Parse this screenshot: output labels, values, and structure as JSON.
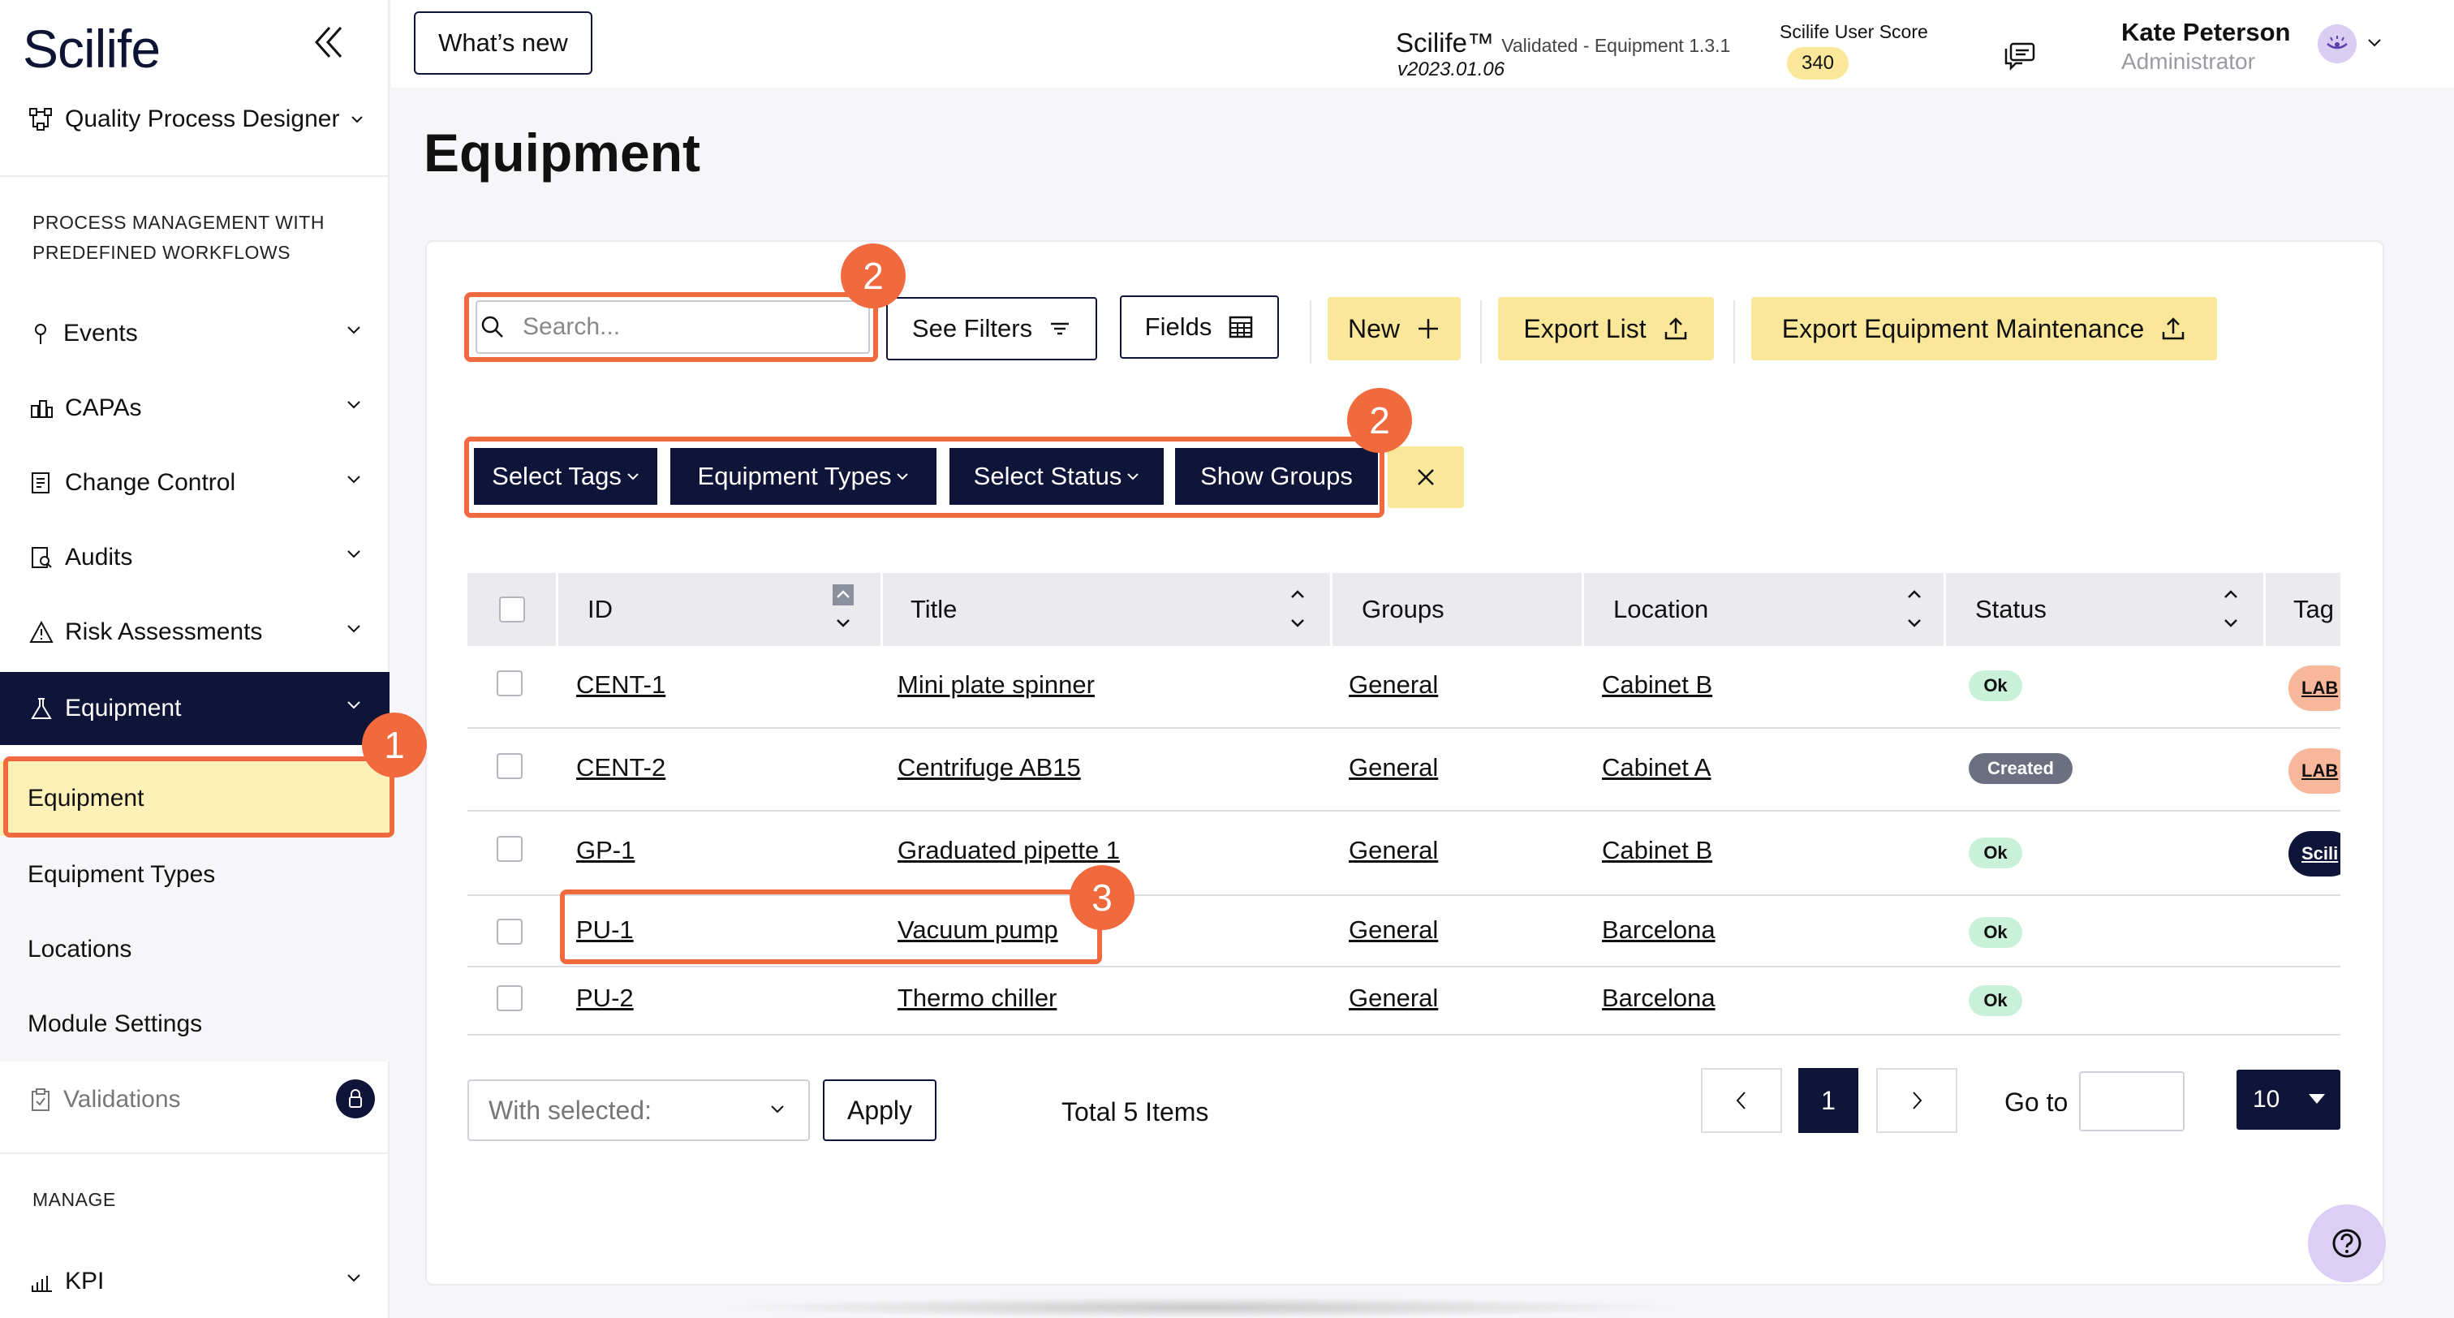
{
  "sidebar": {
    "logo": "Scilife",
    "module": "Quality Process Designer",
    "section1_line1": "PROCESS MANAGEMENT WITH",
    "section1_line2": "PREDEFINED WORKFLOWS",
    "items": [
      {
        "label": "Events",
        "icon": "pin-icon"
      },
      {
        "label": "CAPAs",
        "icon": "capa-icon"
      },
      {
        "label": "Change Control",
        "icon": "change-icon"
      },
      {
        "label": "Audits",
        "icon": "audit-icon"
      },
      {
        "label": "Risk Assessments",
        "icon": "warning-icon"
      },
      {
        "label": "Equipment",
        "icon": "flask-icon"
      }
    ],
    "sub_items": [
      "Equipment",
      "Equipment Types",
      "Locations",
      "Module Settings"
    ],
    "validations": "Validations",
    "section2": "MANAGE",
    "kpi": "KPI"
  },
  "topbar": {
    "whats_new": "What’s new",
    "brand": "Scilife™",
    "brand_sub": "Validated - Equipment 1.3.1",
    "version": "v2023.01.06",
    "score_label": "Scilife User Score",
    "score": "340",
    "user_name": "Kate Peterson",
    "user_role": "Administrator"
  },
  "page": {
    "title": "Equipment"
  },
  "toolbar": {
    "search_placeholder": "Search...",
    "see_filters": "See Filters",
    "fields": "Fields",
    "new": "New",
    "export_list": "Export List",
    "export_maintenance": "Export Equipment Maintenance"
  },
  "filters": {
    "tags": "Select Tags",
    "types": "Equipment Types",
    "status": "Select Status",
    "groups": "Show Groups"
  },
  "markers": {
    "m1": "1",
    "m2a": "2",
    "m2b": "2",
    "m3": "3"
  },
  "table": {
    "headers": {
      "id": "ID",
      "title": "Title",
      "groups": "Groups",
      "location": "Location",
      "status": "Status",
      "tags": "Tag"
    },
    "rows": [
      {
        "id": "CENT-1",
        "title": "Mini plate spinner",
        "group": "General",
        "location": "Cabinet B",
        "status": "Ok",
        "tag": "LAB"
      },
      {
        "id": "CENT-2",
        "title": "Centrifuge AB15",
        "group": "General",
        "location": "Cabinet A",
        "status": "Created",
        "tag": "LAB"
      },
      {
        "id": "GP-1",
        "title": "Graduated pipette 1",
        "group": "General",
        "location": "Cabinet B",
        "status": "Ok",
        "tag": "Scili"
      },
      {
        "id": "PU-1",
        "title": "Vacuum pump",
        "group": "General",
        "location": "Barcelona",
        "status": "Ok",
        "tag": ""
      },
      {
        "id": "PU-2",
        "title": "Thermo chiller",
        "group": "General",
        "location": "Barcelona",
        "status": "Ok",
        "tag": ""
      }
    ]
  },
  "footer": {
    "with_selected": "With selected:",
    "apply": "Apply",
    "total": "Total 5 Items",
    "current_page": "1",
    "goto": "Go to",
    "per_page": "10"
  },
  "colors": {
    "navy": "#0f1538",
    "accent_yellow": "#fbe79a",
    "highlight": "#f06a3e",
    "status_ok": "#c9f1d9",
    "status_created": "#6b6f80",
    "tag_lab": "#f8b79a"
  }
}
